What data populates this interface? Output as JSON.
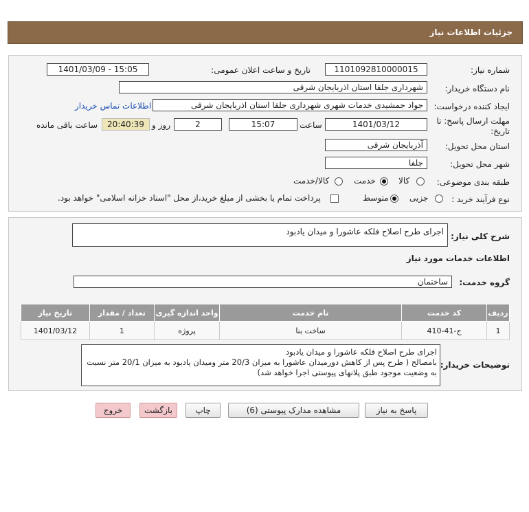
{
  "header": {
    "title": "جزئیات اطلاعات نیاز"
  },
  "form": {
    "need_number_label": "شماره نیاز:",
    "need_number": "1101092810000015",
    "announce_label": "تاریخ و ساعت اعلان عمومی:",
    "announce_value": "1401/03/09 - 15:05",
    "buyer_org_label": "نام دستگاه خریدار:",
    "buyer_org": "شهرداری جلفا استان اذربایجان شرقی",
    "creator_label": "ایجاد کننده درخواست:",
    "creator": "جواد جمشیدی  خدمات شهری شهرداری جلفا استان اذربایجان شرقی",
    "contact_link": "اطلاعات تماس خریدار",
    "deadline_label_1": "مهلت ارسال پاسخ: تا",
    "deadline_label_2": "تاریخ:",
    "deadline_date": "1401/03/12",
    "time_label": "ساعت",
    "deadline_time": "15:07",
    "days_value": "2",
    "days_label": "روز و",
    "remaining_time": "20:40:39",
    "remaining_label": "ساعت باقی مانده",
    "province_label": "استان محل تحویل:",
    "province": "آذربایجان شرقی",
    "city_label": "شهر محل تحویل:",
    "city": "جلفا",
    "category_label": "طبقه بندی موضوعی:",
    "category_options": [
      "کالا",
      "خدمت",
      "کالا/خدمت"
    ],
    "category_selected": "خدمت",
    "process_label": "نوع فرآیند خرید :",
    "process_options": [
      "جزیی",
      "متوسط"
    ],
    "process_selected": "متوسط",
    "payment_note": "پرداخت تمام یا بخشی از مبلغ خرید،از محل \"اسناد خزانه اسلامی\" خواهد بود."
  },
  "summary": {
    "label": "شرح کلی نیاز:",
    "value": "اجرای طرح اصلاح فلکه عاشورا و میدان یادبود"
  },
  "services": {
    "section_title": "اطلاعات خدمات مورد نیاز",
    "group_label": "گروه خدمت:",
    "group_value": "ساختمان",
    "columns": [
      "ردیف",
      "کد خدمت",
      "نام خدمت",
      "واحد اندازه گیری",
      "تعداد / مقدار",
      "تاریخ نیاز"
    ],
    "rows": [
      [
        "1",
        "ج-41-410",
        "ساخت بنا",
        "پروژه",
        "1",
        "1401/03/12"
      ]
    ]
  },
  "buyer_notes": {
    "label": "توضیحات خریدار:",
    "line1": "اجرای طرح اصلاح فلکه عاشورا و میدان یادبود",
    "line2": "بامصالح ( طرح پس از کاهش دورمیدان عاشورا به میزان 20/3 متر ومیدان یادبود به میزان 20/1 متر نسبت",
    "line3": "به وضعیت موجود طبق پلانهای پیوستی  اجرا خواهد شد)"
  },
  "buttons": {
    "reply": "پاسخ به نیاز",
    "attachments": "مشاهده مدارک پیوستی (6)",
    "print": "چاپ",
    "back": "بازگشت",
    "exit": "خروج"
  },
  "colors": {
    "header_bg": "#8b6a4a",
    "table_header_bg": "#9a9a9a",
    "button_pink": "#f3c9cd",
    "link": "#1a4fb5"
  }
}
